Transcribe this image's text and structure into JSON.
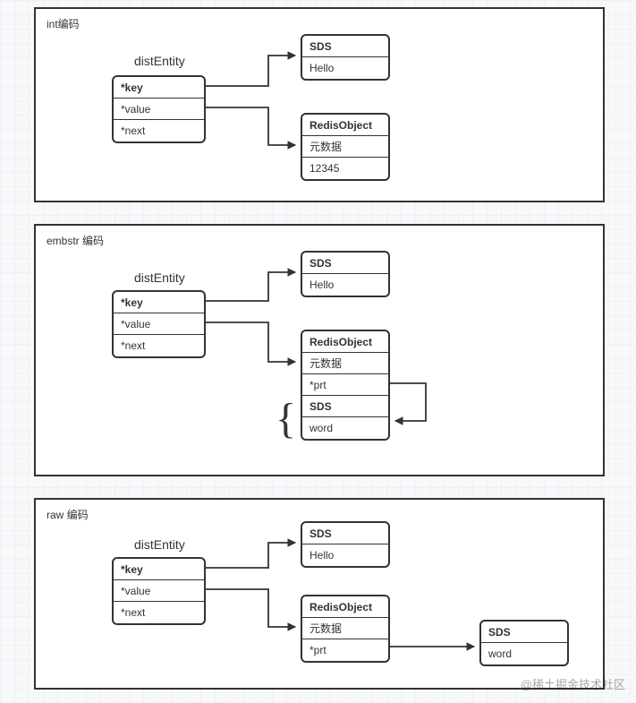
{
  "panels": {
    "p1": {
      "label": "int编码"
    },
    "p2": {
      "label": "embstr 编码"
    },
    "p3": {
      "label": "raw 编码"
    }
  },
  "entity": {
    "title": "distEntity",
    "fields": {
      "key": "*key",
      "value": "*value",
      "next": "*next"
    }
  },
  "sds": {
    "header": "SDS",
    "hello": "Hello",
    "word": "word"
  },
  "redisObject": {
    "header": "RedisObject",
    "meta": "元数据",
    "intval": "12345",
    "ptr": "*prt"
  },
  "watermark": "@稀土掘金技术社区"
}
